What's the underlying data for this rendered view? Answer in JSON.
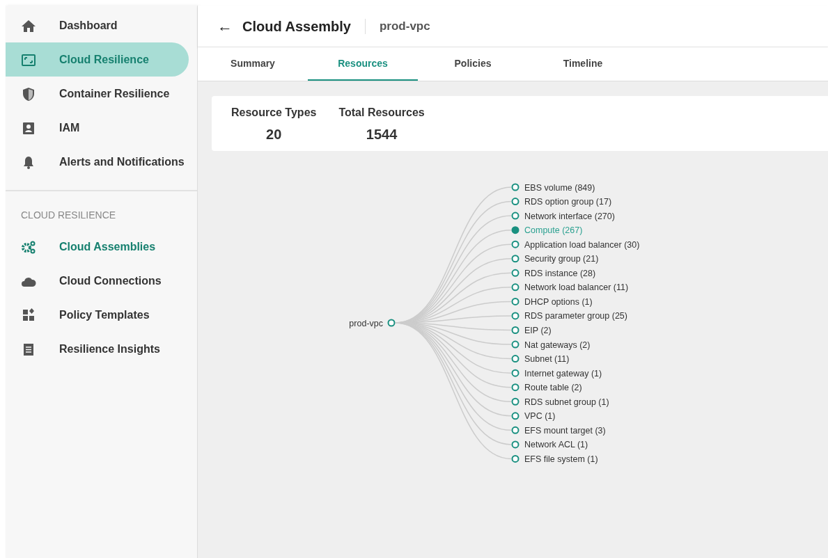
{
  "sidebar": {
    "items": [
      {
        "label": "Dashboard",
        "selected": false
      },
      {
        "label": "Cloud Resilience",
        "selected": true
      },
      {
        "label": "Container Resilience",
        "selected": false
      },
      {
        "label": "IAM",
        "selected": false
      },
      {
        "label": "Alerts and Notifications",
        "selected": false
      }
    ],
    "section_title": "CLOUD RESILIENCE",
    "section_items": [
      {
        "label": "Cloud Assemblies",
        "selected": true
      },
      {
        "label": "Cloud Connections",
        "selected": false
      },
      {
        "label": "Policy Templates",
        "selected": false
      },
      {
        "label": "Resilience Insights",
        "selected": false
      }
    ]
  },
  "header": {
    "back": "←",
    "title": "Cloud Assembly",
    "subtitle": "prod-vpc"
  },
  "tabs": [
    {
      "label": "Summary",
      "selected": false
    },
    {
      "label": "Resources",
      "selected": true
    },
    {
      "label": "Policies",
      "selected": false
    },
    {
      "label": "Timeline",
      "selected": false
    }
  ],
  "stats": [
    {
      "label": "Resource Types",
      "value": "20"
    },
    {
      "label": "Total Resources",
      "value": "1544"
    }
  ],
  "tree": {
    "label": "prod-vpc",
    "children": [
      {
        "label": "EBS volume (849)",
        "selected": false
      },
      {
        "label": "RDS option group (17)",
        "selected": false
      },
      {
        "label": "Network interface (270)",
        "selected": false
      },
      {
        "label": "Compute (267)",
        "selected": true
      },
      {
        "label": "Application load balancer (30)",
        "selected": false
      },
      {
        "label": "Security group (21)",
        "selected": false
      },
      {
        "label": "RDS instance (28)",
        "selected": false
      },
      {
        "label": "Network load balancer (11)",
        "selected": false
      },
      {
        "label": "DHCP options (1)",
        "selected": false
      },
      {
        "label": "RDS parameter group (25)",
        "selected": false
      },
      {
        "label": "EIP (2)",
        "selected": false
      },
      {
        "label": "Nat gateways (2)",
        "selected": false
      },
      {
        "label": "Subnet (11)",
        "selected": false
      },
      {
        "label": "Internet gateway (1)",
        "selected": false
      },
      {
        "label": "Route table (2)",
        "selected": false
      },
      {
        "label": "RDS subnet group (1)",
        "selected": false
      },
      {
        "label": "VPC (1)",
        "selected": false
      },
      {
        "label": "EFS mount target (3)",
        "selected": false
      },
      {
        "label": "Network ACL (1)",
        "selected": false
      },
      {
        "label": "EFS file system (1)",
        "selected": false
      }
    ]
  }
}
